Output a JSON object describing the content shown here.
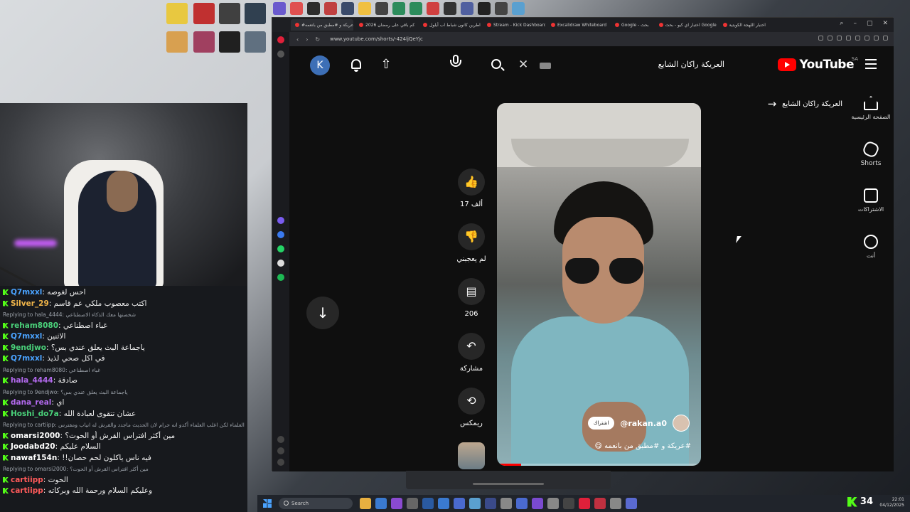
{
  "browser": {
    "tabs": [
      {
        "title": "#عريكة و #مطبق من بانعمه"
      },
      {
        "title": "كم باقي على رمضان 2026"
      },
      {
        "title": "اطرين كانون شباط اب أيلول"
      },
      {
        "title": "Stream - Kick Dashboard"
      },
      {
        "title": "Excalidraw Whiteboard"
      },
      {
        "title": "Google - بحث"
      },
      {
        "title": "اختبار اي كيو - بحث Google"
      },
      {
        "title": "اختبار اللهجة الكويتية"
      }
    ],
    "url": "www.youtube.com/shorts/-424ljQeYjc"
  },
  "youtube": {
    "logo_text": "YouTube",
    "region": "SA",
    "avatar_letter": "K",
    "search_query": "العريكة راكان الشايع",
    "shorts_header": "العريكة راكان الشايع",
    "sidebar": [
      {
        "label": "الصفحة الرئيسية",
        "icon": "home-icon"
      },
      {
        "label": "Shorts",
        "icon": "shorts-icon"
      },
      {
        "label": "الاشتراكات",
        "icon": "subscriptions-icon"
      },
      {
        "label": "أنت",
        "icon": "account-icon"
      }
    ],
    "actions": {
      "like_count": "17 ألف",
      "dislike_label": "لم يعجبني",
      "comment_count": "206",
      "share_label": "مشاركة",
      "remix_label": "ريمكس"
    },
    "video": {
      "channel": "@rakan.a0",
      "subscribe_label": "اشتراك",
      "caption": "#عريكة و #مطبق من بانعمه 😋",
      "progress": 0.12
    }
  },
  "chat": {
    "lines": [
      {
        "type": "msg",
        "user": "Q7mxxl",
        "color": "#4aa3ff",
        "text": "احس لغوصه"
      },
      {
        "type": "msg",
        "user": "Silver_29",
        "color": "#f0b54a",
        "text": "اكتب معصوب ملكي عم قاسم"
      },
      {
        "type": "reply",
        "text": "Replying to  hala_4444: شخصنها معك الذكاء الاصطناعي"
      },
      {
        "type": "msg",
        "user": "reham8080",
        "color": "#4ad17a",
        "text": "غباء اصطناعي"
      },
      {
        "type": "msg",
        "user": "Q7mxxl",
        "color": "#4aa3ff",
        "text": "الاثنين"
      },
      {
        "type": "msg",
        "user": "9endjwo",
        "color": "#4ad17a",
        "text": "ياجماعة البث يعلق عندي بس؟"
      },
      {
        "type": "msg",
        "user": "Q7mxxl",
        "color": "#4aa3ff",
        "text": "في اكل صحي لذيذ"
      },
      {
        "type": "reply",
        "text": "Replying to  reham8080: غباء اصطناعي"
      },
      {
        "type": "msg",
        "user": "hala_4444",
        "color": "#b46af0",
        "text": "صادقة"
      },
      {
        "type": "reply",
        "text": "Replying to  9endjwo: ياجماعة البث يعلق عندي بس؟"
      },
      {
        "type": "msg",
        "user": "dana_real",
        "color": "#b46af0",
        "text": "اي"
      },
      {
        "type": "msg",
        "user": "Hoshi_do7a",
        "color": "#4ad17a",
        "text": "عشان تتقوى لعبادة الله"
      },
      {
        "type": "reply",
        "text": "Replying to  cartiipp: اختلف العلماء لكن اغلب العلماء أكدو انه حرام لان الحديث ماجدد والقرش له انياب ومفترس"
      },
      {
        "type": "msg",
        "user": "omarsi2000",
        "color": "#ffffff",
        "text": "مين أكثر افتراس القرش أو الحوت؟"
      },
      {
        "type": "msg",
        "user": "Joodabd20",
        "color": "#ffffff",
        "text": "السلام عليكم"
      },
      {
        "type": "msg",
        "user": "nawaf154n",
        "color": "#ffffff",
        "text": "!!فيه ناس ياكلون لحم حصان"
      },
      {
        "type": "reply",
        "text": "Replying to  omarsi2000: مين أكثر افتراس القرش أو الحوت؟"
      },
      {
        "type": "msg",
        "user": "cartiipp",
        "color": "#ff5a5a",
        "text": "الحوت"
      },
      {
        "type": "msg",
        "user": "cartiipp",
        "color": "#ff5a5a",
        "text": "وعليكم السلام ورحمة الله وبركاته"
      }
    ]
  },
  "taskbar": {
    "search_placeholder": "Search",
    "viewer_count": "34",
    "time": "22:01",
    "date": "04/12/2025"
  },
  "colors": {
    "youtube_red": "#ff0000",
    "kick_green": "#53fc18",
    "browser_bg": "#0f0f0f"
  }
}
